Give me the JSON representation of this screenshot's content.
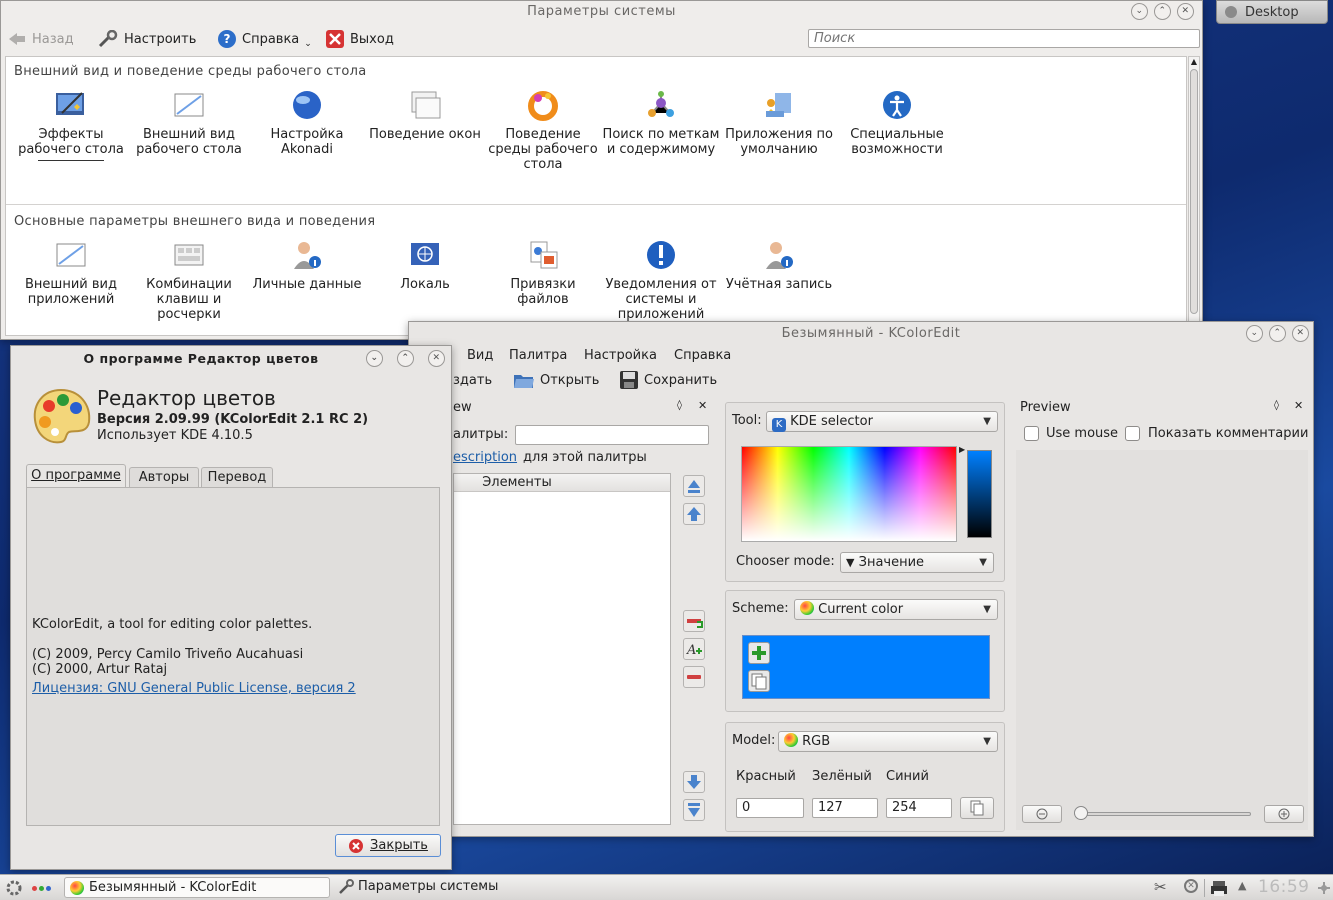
{
  "syswin": {
    "title": "Параметры системы",
    "toolbar": {
      "back": "Назад",
      "configure": "Настроить",
      "help": "Справка",
      "quit": "Выход",
      "search_placeholder": "Поиск"
    },
    "section1": {
      "title": "Внешний вид и поведение среды рабочего стола",
      "items": [
        {
          "label": "Эффекты рабочего стола",
          "icon": "desktop-effects-icon"
        },
        {
          "label": "Внешний вид рабочего стола",
          "icon": "workspace-appearance-icon"
        },
        {
          "label": "Настройка Akonadi",
          "icon": "akonadi-icon"
        },
        {
          "label": "Поведение окон",
          "icon": "window-behavior-icon"
        },
        {
          "label": "Поведение среды рабочего стола",
          "icon": "workspace-behavior-icon"
        },
        {
          "label": "Поиск по меткам и содержимому",
          "icon": "nepomuk-search-icon"
        },
        {
          "label": "Приложения по умолчанию",
          "icon": "default-apps-icon"
        },
        {
          "label": "Специальные возможности",
          "icon": "accessibility-icon"
        }
      ]
    },
    "section2": {
      "title": "Основные параметры внешнего вида и поведения",
      "items": [
        {
          "label": "Внешний вид приложений",
          "icon": "app-appearance-icon"
        },
        {
          "label": "Комбинации клавиш и росчерки",
          "icon": "shortcuts-icon"
        },
        {
          "label": "Личные данные",
          "icon": "personal-info-icon"
        },
        {
          "label": "Локаль",
          "icon": "locale-icon"
        },
        {
          "label": "Привязки файлов",
          "icon": "file-associations-icon"
        },
        {
          "label": "Уведомления от системы и приложений",
          "icon": "notifications-icon"
        },
        {
          "label": "Учётная запись",
          "icon": "user-account-icon"
        }
      ]
    }
  },
  "desktop_btn": "Desktop",
  "kcolor": {
    "title": "Безымянный - KColorEdit",
    "menu": [
      "Вид",
      "Палитра",
      "Настройка",
      "Справка"
    ],
    "toolbar": {
      "new": "здать",
      "open": "Открыть",
      "save": "Сохранить"
    },
    "left": {
      "panel_title": "ew",
      "name_label": "алитры:",
      "desc_link": "escription",
      "desc_rest": "для этой палитры",
      "col_header": "Элементы"
    },
    "center": {
      "tool_label": "Tool:",
      "tool_value": "KDE selector",
      "chooser_label": "Chooser mode:",
      "chooser_value": "Значение",
      "scheme_label": "Scheme:",
      "scheme_value": "Current color",
      "model_label": "Model:",
      "model_value": "RGB",
      "red_label": "Красный",
      "green_label": "Зелёный",
      "blue_label": "Синий",
      "red": "0",
      "green": "127",
      "blue": "254",
      "current_color": "#007ffe"
    },
    "right": {
      "title": "Preview",
      "use_mouse": "Use mouse",
      "show_comments": "Показать комментарии"
    }
  },
  "about": {
    "title": "О программе Редактор цветов",
    "app_name": "Редактор цветов",
    "version": "Версия 2.09.99 (KColorEdit 2.1 RC 2)",
    "uses": "Использует KDE 4.10.5",
    "tabs": [
      "О программе",
      "Авторы",
      "Перевод"
    ],
    "description": "KColorEdit, a tool for editing color palettes.",
    "copyright1": "(C) 2009, Percy Camilo Triveño Aucahuasi",
    "copyright2": "(C) 2000, Artur Rataj",
    "license": "Лицензия: GNU General Public License, версия 2",
    "close": "Закрыть"
  },
  "taskbar": {
    "task1": "Безымянный - KColorEdit",
    "task2": "Параметры системы",
    "clock": "16:59"
  }
}
